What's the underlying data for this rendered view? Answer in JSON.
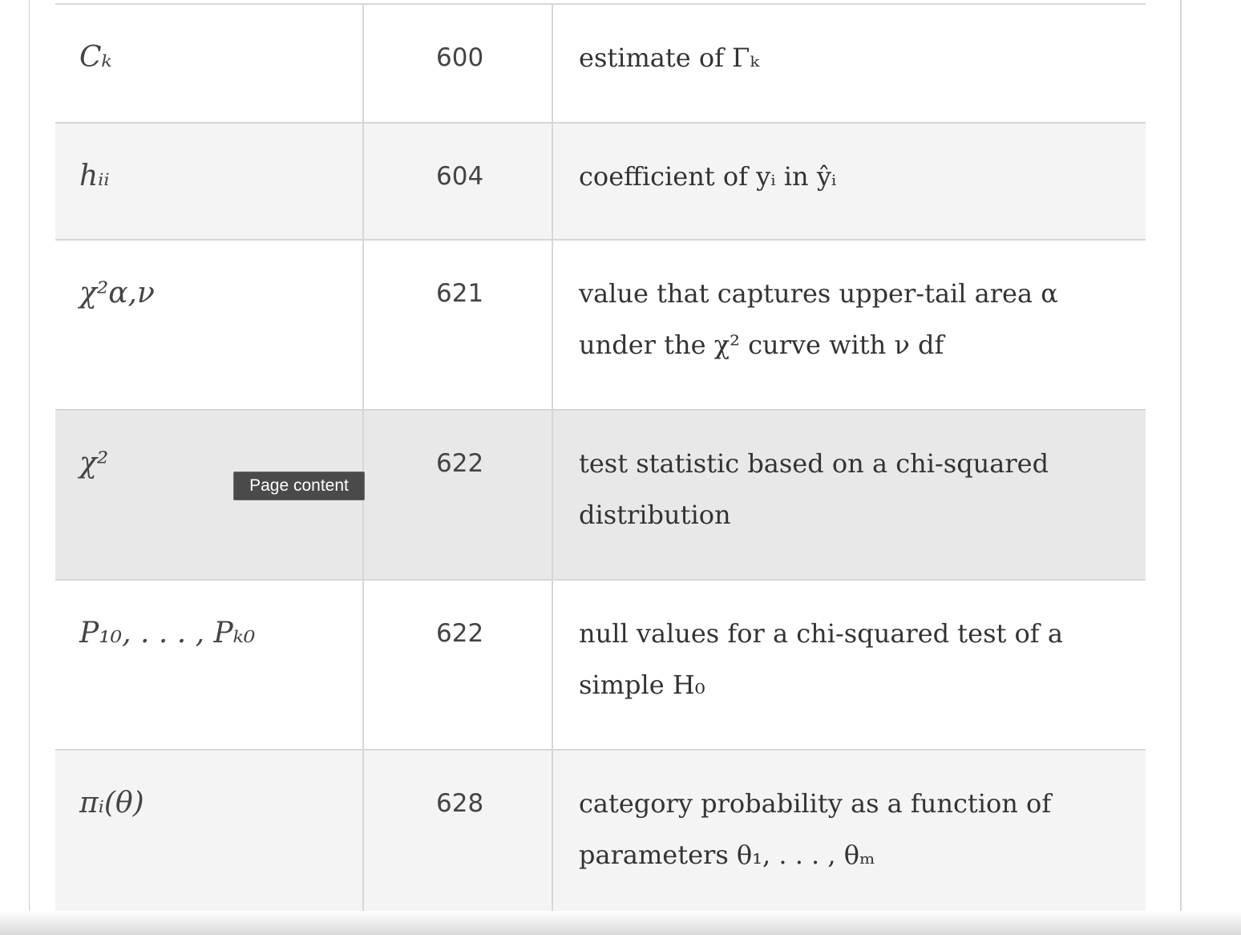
{
  "table": {
    "rows": [
      {
        "symbol": "Cₖ",
        "page": "600",
        "description": "estimate of  Γₖ"
      },
      {
        "symbol": "hᵢᵢ",
        "page": "604",
        "description": "coefficient of  yᵢ  in  ŷᵢ"
      },
      {
        "symbol": "χ²α,ν",
        "page": "621",
        "description": "value that captures upper-tail area  α  under the  χ²  curve with  ν  df"
      },
      {
        "symbol": "χ²",
        "page": "622",
        "description": "test statistic based on a chi-squared distribution"
      },
      {
        "symbol": "P₁₀, . . . , Pₖ₀",
        "page": "622",
        "description": "null values for a chi-squared test of a simple  H₀"
      },
      {
        "symbol": "πᵢ(θ)",
        "page": "628",
        "description": "category probability as a function of parameters  θ₁, . . . , θₘ"
      }
    ]
  },
  "tooltip": {
    "label": "Page content"
  }
}
